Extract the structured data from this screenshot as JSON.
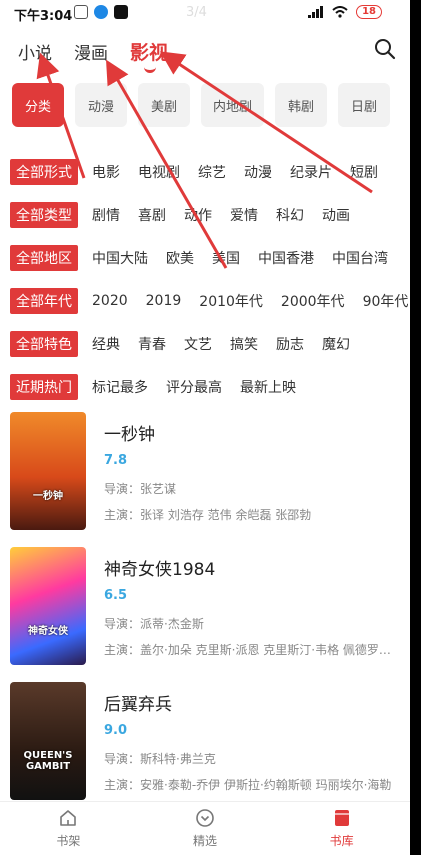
{
  "status_bar": {
    "time": "下午3:04",
    "page_indicator": "3/4",
    "battery": "18"
  },
  "top_tabs": [
    {
      "label": "小说",
      "active": false
    },
    {
      "label": "漫画",
      "active": false
    },
    {
      "label": "影视",
      "active": true
    }
  ],
  "category_chips": [
    {
      "label": "分类",
      "active": true
    },
    {
      "label": "动漫",
      "active": false
    },
    {
      "label": "美剧",
      "active": false
    },
    {
      "label": "内地剧",
      "active": false
    },
    {
      "label": "韩剧",
      "active": false
    },
    {
      "label": "日剧",
      "active": false
    }
  ],
  "filters": [
    {
      "label": "全部形式",
      "options": [
        "电影",
        "电视剧",
        "综艺",
        "动漫",
        "纪录片",
        "短剧"
      ]
    },
    {
      "label": "全部类型",
      "options": [
        "剧情",
        "喜剧",
        "动作",
        "爱情",
        "科幻",
        "动画"
      ]
    },
    {
      "label": "全部地区",
      "options": [
        "中国大陆",
        "欧美",
        "美国",
        "中国香港",
        "中国台湾"
      ]
    },
    {
      "label": "全部年代",
      "options": [
        "2020",
        "2019",
        "2010年代",
        "2000年代",
        "90年代"
      ]
    },
    {
      "label": "全部特色",
      "options": [
        "经典",
        "青春",
        "文艺",
        "搞笑",
        "励志",
        "魔幻"
      ]
    },
    {
      "label": "近期热门",
      "options": [
        "标记最多",
        "评分最高",
        "最新上映"
      ]
    }
  ],
  "movies": [
    {
      "title": "一秒钟",
      "score": "7.8",
      "director": "导演：张艺谋",
      "cast": "主演：张译 刘浩存 范伟 余皑磊 张邵勃",
      "poster_text": "一秒钟"
    },
    {
      "title": "神奇女侠1984",
      "score": "6.5",
      "director": "导演：派蒂·杰金斯",
      "cast": "主演：盖尔·加朵 克里斯·派恩 克里斯汀·韦格 佩德罗·帕斯卡",
      "poster_text": "神奇女侠"
    },
    {
      "title": "后翼弃兵",
      "score": "9.0",
      "director": "导演：斯科特·弗兰克",
      "cast": "主演：安雅·泰勒-乔伊 伊斯拉·约翰斯顿 玛丽埃尔·海勒",
      "poster_text": "QUEEN'S GAMBIT"
    }
  ],
  "bottom_nav": [
    {
      "label": "书架",
      "icon": "home-icon",
      "active": false
    },
    {
      "label": "精选",
      "icon": "compass-icon",
      "active": false
    },
    {
      "label": "书库",
      "icon": "book-icon",
      "active": true
    }
  ],
  "colors": {
    "accent": "#e03a3a",
    "score": "#3aa7e0",
    "text": "#222222",
    "muted": "#888888",
    "chip_bg": "#f2f2f2"
  }
}
